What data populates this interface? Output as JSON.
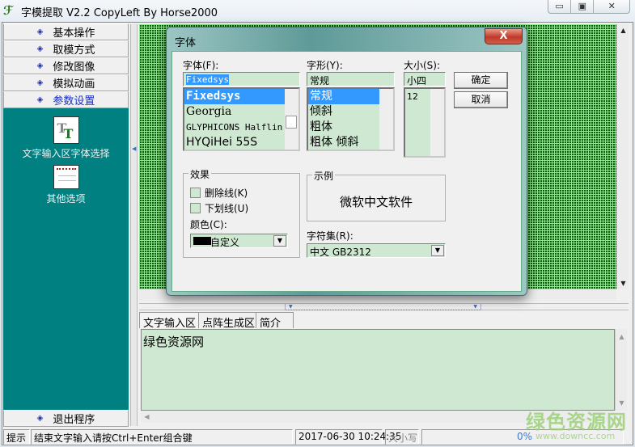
{
  "window": {
    "title": "字模提取 V2.2  CopyLeft By Horse2000",
    "controls": [
      "minimize",
      "maximize",
      "close"
    ]
  },
  "sidebar": {
    "items": [
      {
        "label": "基本操作"
      },
      {
        "label": "取模方式"
      },
      {
        "label": "修改图像"
      },
      {
        "label": "模拟动画"
      },
      {
        "label": "参数设置"
      }
    ],
    "tools": [
      {
        "label": "文字输入区字体选择",
        "icon": "font-tt-icon"
      },
      {
        "label": "其他选项",
        "icon": "options-document-icon"
      }
    ],
    "exit_label": "退出程序"
  },
  "dialog": {
    "title": "字体",
    "close": "X",
    "font_label": "字体(F):",
    "font_value": "Fixedsys",
    "fonts": [
      "Fixedsys",
      "Georgia",
      "GLYPHICONS Halflin",
      "HYQiHei 55S"
    ],
    "style_label": "字形(Y):",
    "style_value": "常规",
    "styles": [
      "常规",
      "倾斜",
      "粗体",
      "粗体 倾斜"
    ],
    "size_label": "大小(S):",
    "size_value": "小四",
    "sizes": [
      "12"
    ],
    "ok": "确定",
    "cancel": "取消",
    "effects_title": "效果",
    "strikeout": "删除线(K)",
    "underline": "下划线(U)",
    "color_label": "颜色(C):",
    "color_value": "自定义",
    "color_swatch": "#000000",
    "sample_title": "示例",
    "sample_text": "微软中文软件",
    "charset_label": "字符集(R):",
    "charset_value": "中文 GB2312"
  },
  "tabs": [
    {
      "label": "文字输入区"
    },
    {
      "label": "点阵生成区"
    },
    {
      "label": "简介"
    }
  ],
  "text_input": {
    "value": "绿色资源网"
  },
  "status": {
    "hint_label": "提示",
    "message": "结束文字输入请按Ctrl+Enter组合键",
    "datetime": "2017-06-30 10:24:35",
    "caps": "大小写",
    "progress": "0%"
  },
  "watermark": {
    "text": "绿色资源网",
    "url": "www.downcc.com"
  },
  "colors": {
    "teal": "#008080",
    "field_green": "#cfe8d2",
    "selection": "#3399ff"
  }
}
